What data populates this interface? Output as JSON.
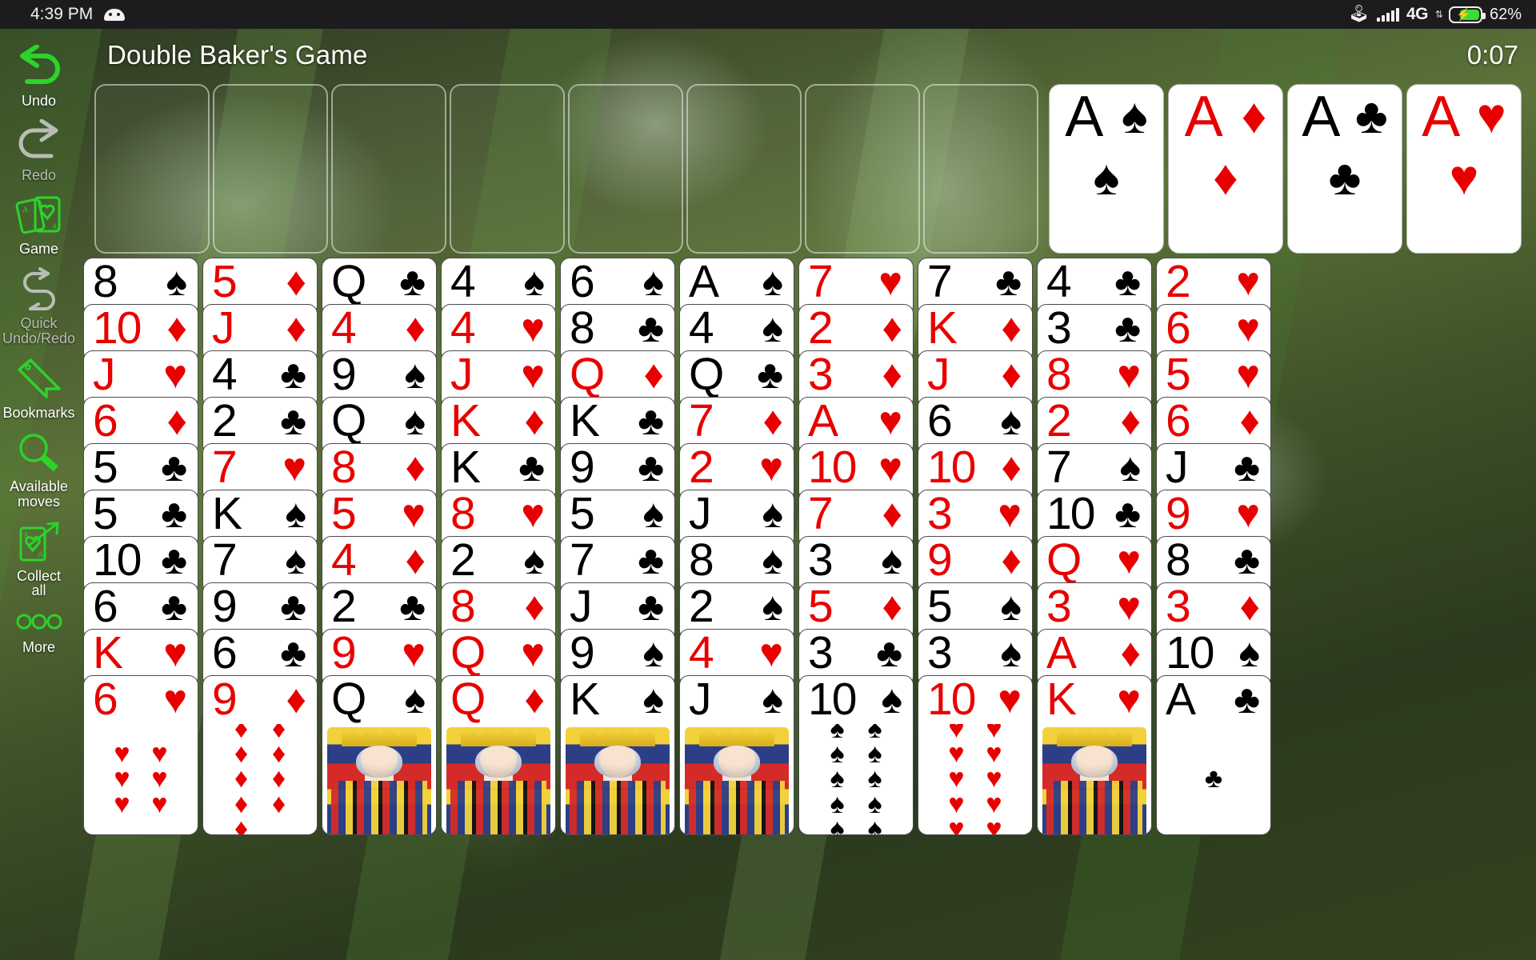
{
  "status_bar": {
    "time": "4:39 PM",
    "android_icon": "android-head-icon",
    "bluetooth_icon": "bluetooth-icon",
    "signal_icon": "signal-bars-icon",
    "network_type": "4G",
    "data_arrows": "⇅",
    "battery_icon": "battery-charging-icon",
    "battery_percent": "62%"
  },
  "header": {
    "title": "Double Baker's Game",
    "timer": "0:07"
  },
  "sidebar": {
    "items": [
      {
        "label": "Undo",
        "icon": "undo-arrow-icon",
        "enabled": true
      },
      {
        "label": "Redo",
        "icon": "redo-arrow-icon",
        "enabled": false
      },
      {
        "label": "Game",
        "icon": "two-cards-icon",
        "enabled": true
      },
      {
        "label": "Quick\nUndo/Redo",
        "icon": "quick-undo-redo-icon",
        "enabled": false
      },
      {
        "label": "Bookmarks",
        "icon": "bookmark-tag-icon",
        "enabled": true
      },
      {
        "label": "Available\nmoves",
        "icon": "magnifier-icon",
        "enabled": true
      },
      {
        "label": "Collect\nall",
        "icon": "collect-all-icon",
        "enabled": true
      },
      {
        "label": "More",
        "icon": "three-dots-icon",
        "enabled": true
      }
    ]
  },
  "free_cells": [
    {
      "name": "free-cell-1",
      "card": null
    },
    {
      "name": "free-cell-2",
      "card": null
    },
    {
      "name": "free-cell-3",
      "card": null
    },
    {
      "name": "free-cell-4",
      "card": null
    },
    {
      "name": "free-cell-5",
      "card": null
    },
    {
      "name": "free-cell-6",
      "card": null
    },
    {
      "name": "free-cell-7",
      "card": null
    },
    {
      "name": "free-cell-8",
      "card": null
    }
  ],
  "foundations": [
    {
      "rank": "A",
      "suit": "♠",
      "color": "black"
    },
    {
      "rank": "A",
      "suit": "♦",
      "color": "red"
    },
    {
      "rank": "A",
      "suit": "♣",
      "color": "black"
    },
    {
      "rank": "A",
      "suit": "♥",
      "color": "red"
    }
  ],
  "colors": {
    "red": "#e80000",
    "black": "#000000",
    "accent_green": "#2bd32b",
    "status_bar_bg": "#1c1c1e",
    "battery_fill": "#3ddc32"
  },
  "tableau": [
    {
      "name": "tableau-column-1",
      "cards": [
        {
          "rank": "8",
          "suit": "♠",
          "color": "black"
        },
        {
          "rank": "10",
          "suit": "♦",
          "color": "red"
        },
        {
          "rank": "J",
          "suit": "♥",
          "color": "red"
        },
        {
          "rank": "6",
          "suit": "♦",
          "color": "red"
        },
        {
          "rank": "5",
          "suit": "♣",
          "color": "black"
        },
        {
          "rank": "5",
          "suit": "♣",
          "color": "black"
        },
        {
          "rank": "10",
          "suit": "♣",
          "color": "black"
        },
        {
          "rank": "6",
          "suit": "♣",
          "color": "black"
        },
        {
          "rank": "K",
          "suit": "♥",
          "color": "red"
        },
        {
          "rank": "6",
          "suit": "♥",
          "color": "red",
          "art": "pips6"
        }
      ]
    },
    {
      "name": "tableau-column-2",
      "cards": [
        {
          "rank": "5",
          "suit": "♦",
          "color": "red"
        },
        {
          "rank": "J",
          "suit": "♦",
          "color": "red"
        },
        {
          "rank": "4",
          "suit": "♣",
          "color": "black"
        },
        {
          "rank": "2",
          "suit": "♣",
          "color": "black"
        },
        {
          "rank": "7",
          "suit": "♥",
          "color": "red"
        },
        {
          "rank": "K",
          "suit": "♠",
          "color": "black"
        },
        {
          "rank": "7",
          "suit": "♠",
          "color": "black"
        },
        {
          "rank": "9",
          "suit": "♣",
          "color": "black"
        },
        {
          "rank": "6",
          "suit": "♣",
          "color": "black"
        },
        {
          "rank": "9",
          "suit": "♦",
          "color": "red",
          "art": "pips9"
        }
      ]
    },
    {
      "name": "tableau-column-3",
      "cards": [
        {
          "rank": "Q",
          "suit": "♣",
          "color": "black"
        },
        {
          "rank": "4",
          "suit": "♦",
          "color": "red"
        },
        {
          "rank": "9",
          "suit": "♠",
          "color": "black"
        },
        {
          "rank": "Q",
          "suit": "♠",
          "color": "black"
        },
        {
          "rank": "8",
          "suit": "♦",
          "color": "red"
        },
        {
          "rank": "5",
          "suit": "♥",
          "color": "red"
        },
        {
          "rank": "4",
          "suit": "♦",
          "color": "red"
        },
        {
          "rank": "2",
          "suit": "♣",
          "color": "black"
        },
        {
          "rank": "9",
          "suit": "♥",
          "color": "red"
        },
        {
          "rank": "Q",
          "suit": "♠",
          "color": "black",
          "art": "court"
        }
      ]
    },
    {
      "name": "tableau-column-4",
      "cards": [
        {
          "rank": "4",
          "suit": "♠",
          "color": "black"
        },
        {
          "rank": "4",
          "suit": "♥",
          "color": "red"
        },
        {
          "rank": "J",
          "suit": "♥",
          "color": "red"
        },
        {
          "rank": "K",
          "suit": "♦",
          "color": "red"
        },
        {
          "rank": "K",
          "suit": "♣",
          "color": "black"
        },
        {
          "rank": "8",
          "suit": "♥",
          "color": "red"
        },
        {
          "rank": "2",
          "suit": "♠",
          "color": "black"
        },
        {
          "rank": "8",
          "suit": "♦",
          "color": "red"
        },
        {
          "rank": "Q",
          "suit": "♥",
          "color": "red"
        },
        {
          "rank": "Q",
          "suit": "♦",
          "color": "red",
          "art": "court"
        }
      ]
    },
    {
      "name": "tableau-column-5",
      "cards": [
        {
          "rank": "6",
          "suit": "♠",
          "color": "black"
        },
        {
          "rank": "8",
          "suit": "♣",
          "color": "black"
        },
        {
          "rank": "Q",
          "suit": "♦",
          "color": "red"
        },
        {
          "rank": "K",
          "suit": "♣",
          "color": "black"
        },
        {
          "rank": "9",
          "suit": "♣",
          "color": "black"
        },
        {
          "rank": "5",
          "suit": "♠",
          "color": "black"
        },
        {
          "rank": "7",
          "suit": "♣",
          "color": "black"
        },
        {
          "rank": "J",
          "suit": "♣",
          "color": "black"
        },
        {
          "rank": "9",
          "suit": "♠",
          "color": "black"
        },
        {
          "rank": "K",
          "suit": "♠",
          "color": "black",
          "art": "court"
        }
      ]
    },
    {
      "name": "tableau-column-6",
      "cards": [
        {
          "rank": "A",
          "suit": "♠",
          "color": "black"
        },
        {
          "rank": "4",
          "suit": "♠",
          "color": "black"
        },
        {
          "rank": "Q",
          "suit": "♣",
          "color": "black"
        },
        {
          "rank": "7",
          "suit": "♦",
          "color": "red"
        },
        {
          "rank": "2",
          "suit": "♥",
          "color": "red"
        },
        {
          "rank": "J",
          "suit": "♠",
          "color": "black"
        },
        {
          "rank": "8",
          "suit": "♠",
          "color": "black"
        },
        {
          "rank": "2",
          "suit": "♠",
          "color": "black"
        },
        {
          "rank": "4",
          "suit": "♥",
          "color": "red"
        },
        {
          "rank": "J",
          "suit": "♠",
          "color": "black",
          "art": "court"
        }
      ]
    },
    {
      "name": "tableau-column-7",
      "cards": [
        {
          "rank": "7",
          "suit": "♥",
          "color": "red"
        },
        {
          "rank": "2",
          "suit": "♦",
          "color": "red"
        },
        {
          "rank": "3",
          "suit": "♦",
          "color": "red"
        },
        {
          "rank": "A",
          "suit": "♥",
          "color": "red"
        },
        {
          "rank": "10",
          "suit": "♥",
          "color": "red"
        },
        {
          "rank": "7",
          "suit": "♦",
          "color": "red"
        },
        {
          "rank": "3",
          "suit": "♠",
          "color": "black"
        },
        {
          "rank": "5",
          "suit": "♦",
          "color": "red"
        },
        {
          "rank": "3",
          "suit": "♣",
          "color": "black"
        },
        {
          "rank": "10",
          "suit": "♠",
          "color": "black",
          "art": "pips10"
        }
      ]
    },
    {
      "name": "tableau-column-8",
      "cards": [
        {
          "rank": "7",
          "suit": "♣",
          "color": "black"
        },
        {
          "rank": "K",
          "suit": "♦",
          "color": "red"
        },
        {
          "rank": "J",
          "suit": "♦",
          "color": "red"
        },
        {
          "rank": "6",
          "suit": "♠",
          "color": "black"
        },
        {
          "rank": "10",
          "suit": "♦",
          "color": "red"
        },
        {
          "rank": "3",
          "suit": "♥",
          "color": "red"
        },
        {
          "rank": "9",
          "suit": "♦",
          "color": "red"
        },
        {
          "rank": "5",
          "suit": "♠",
          "color": "black"
        },
        {
          "rank": "3",
          "suit": "♠",
          "color": "black"
        },
        {
          "rank": "10",
          "suit": "♥",
          "color": "red",
          "art": "pips10"
        }
      ]
    },
    {
      "name": "tableau-column-9",
      "cards": [
        {
          "rank": "4",
          "suit": "♣",
          "color": "black"
        },
        {
          "rank": "3",
          "suit": "♣",
          "color": "black"
        },
        {
          "rank": "8",
          "suit": "♥",
          "color": "red"
        },
        {
          "rank": "2",
          "suit": "♦",
          "color": "red"
        },
        {
          "rank": "7",
          "suit": "♠",
          "color": "black"
        },
        {
          "rank": "10",
          "suit": "♣",
          "color": "black"
        },
        {
          "rank": "Q",
          "suit": "♥",
          "color": "red"
        },
        {
          "rank": "3",
          "suit": "♥",
          "color": "red"
        },
        {
          "rank": "A",
          "suit": "♦",
          "color": "red"
        },
        {
          "rank": "K",
          "suit": "♥",
          "color": "red",
          "art": "court"
        }
      ]
    },
    {
      "name": "tableau-column-10",
      "cards": [
        {
          "rank": "2",
          "suit": "♥",
          "color": "red"
        },
        {
          "rank": "6",
          "suit": "♥",
          "color": "red"
        },
        {
          "rank": "5",
          "suit": "♥",
          "color": "red"
        },
        {
          "rank": "6",
          "suit": "♦",
          "color": "red"
        },
        {
          "rank": "J",
          "suit": "♣",
          "color": "black"
        },
        {
          "rank": "9",
          "suit": "♥",
          "color": "red"
        },
        {
          "rank": "8",
          "suit": "♣",
          "color": "black"
        },
        {
          "rank": "3",
          "suit": "♦",
          "color": "red"
        },
        {
          "rank": "10",
          "suit": "♠",
          "color": "black"
        },
        {
          "rank": "A",
          "suit": "♣",
          "color": "black",
          "art": "pips1"
        }
      ]
    }
  ]
}
